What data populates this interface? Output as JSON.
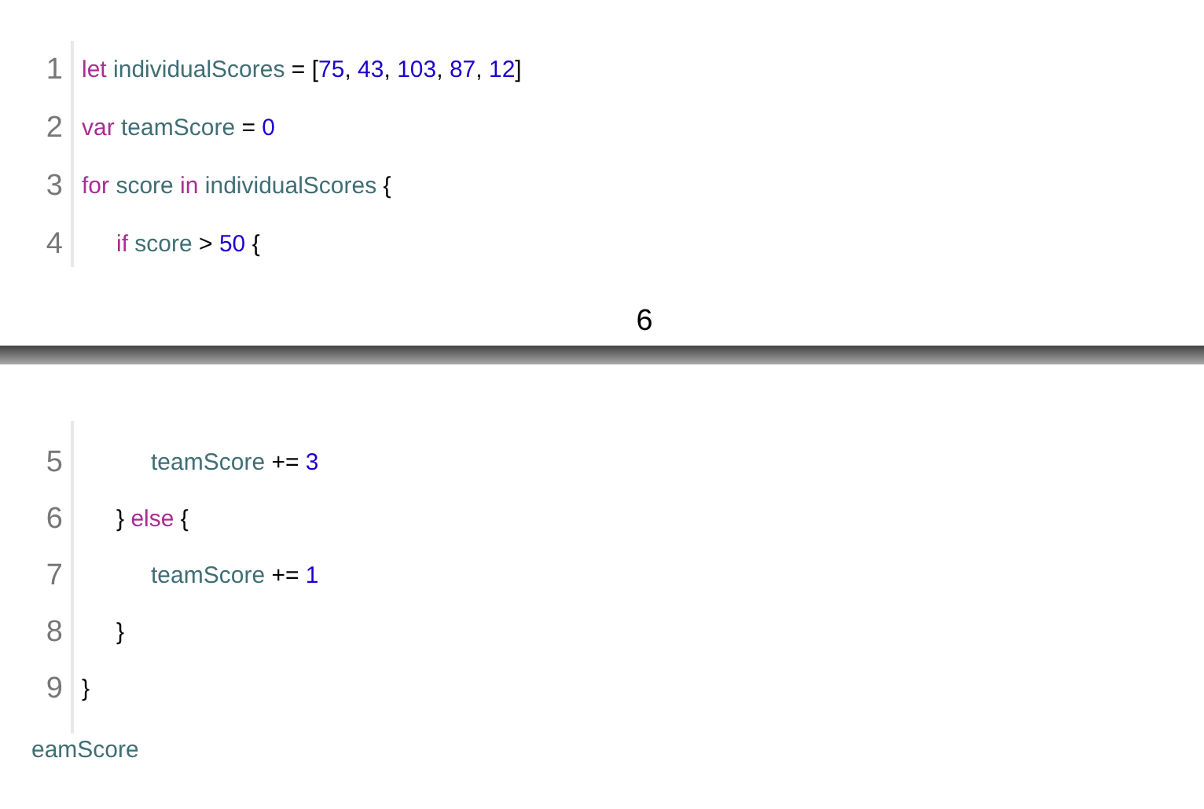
{
  "page_1": {
    "lines": [
      {
        "number": "1",
        "kind": "flush",
        "tokens": [
          {
            "kind": "keyword",
            "text": "let "
          },
          {
            "kind": "ident",
            "text": "individualScores"
          },
          {
            "kind": "plain",
            "text": " = ["
          },
          {
            "kind": "number",
            "text": "75"
          },
          {
            "kind": "plain",
            "text": ", "
          },
          {
            "kind": "number",
            "text": "43"
          },
          {
            "kind": "plain",
            "text": ", "
          },
          {
            "kind": "number",
            "text": "103"
          },
          {
            "kind": "plain",
            "text": ", "
          },
          {
            "kind": "number",
            "text": "87"
          },
          {
            "kind": "plain",
            "text": ", "
          },
          {
            "kind": "number",
            "text": "12"
          },
          {
            "kind": "plain",
            "text": "]"
          }
        ]
      },
      {
        "number": "2",
        "kind": "flush",
        "tokens": [
          {
            "kind": "keyword",
            "text": "var "
          },
          {
            "kind": "ident",
            "text": "teamScore"
          },
          {
            "kind": "plain",
            "text": " = "
          },
          {
            "kind": "number",
            "text": "0"
          }
        ]
      },
      {
        "number": "3",
        "kind": "flush",
        "tokens": [
          {
            "kind": "keyword",
            "text": "for "
          },
          {
            "kind": "ident",
            "text": "score "
          },
          {
            "kind": "keyword",
            "text": "in "
          },
          {
            "kind": "ident",
            "text": "individualScores"
          },
          {
            "kind": "plain",
            "text": " {"
          }
        ]
      },
      {
        "number": "4",
        "kind": "nested",
        "tokens": [
          {
            "kind": "keyword",
            "text": "if "
          },
          {
            "kind": "ident",
            "text": "score"
          },
          {
            "kind": "plain",
            "text": " > "
          },
          {
            "kind": "number",
            "text": "50"
          },
          {
            "kind": "plain",
            "text": " {"
          }
        ]
      }
    ]
  },
  "page_number": "6",
  "page_2": {
    "lines": [
      {
        "number": "5",
        "kind": "deep",
        "tokens": [
          {
            "kind": "ident",
            "text": "teamScore"
          },
          {
            "kind": "plain",
            "text": " += "
          },
          {
            "kind": "number",
            "text": "3"
          }
        ]
      },
      {
        "number": "6",
        "kind": "nested",
        "tokens": [
          {
            "kind": "plain",
            "text": "} "
          },
          {
            "kind": "keyword",
            "text": "else"
          },
          {
            "kind": "plain",
            "text": " {"
          }
        ]
      },
      {
        "number": "7",
        "kind": "deep",
        "tokens": [
          {
            "kind": "ident",
            "text": "teamScore"
          },
          {
            "kind": "plain",
            "text": " += "
          },
          {
            "kind": "number",
            "text": "1"
          }
        ]
      },
      {
        "number": "8",
        "kind": "nested",
        "tokens": [
          {
            "kind": "plain",
            "text": "}"
          }
        ]
      },
      {
        "number": "9",
        "kind": "flush",
        "tokens": [
          {
            "kind": "plain",
            "text": "}"
          }
        ]
      }
    ],
    "trailing_text": "eamScore"
  }
}
